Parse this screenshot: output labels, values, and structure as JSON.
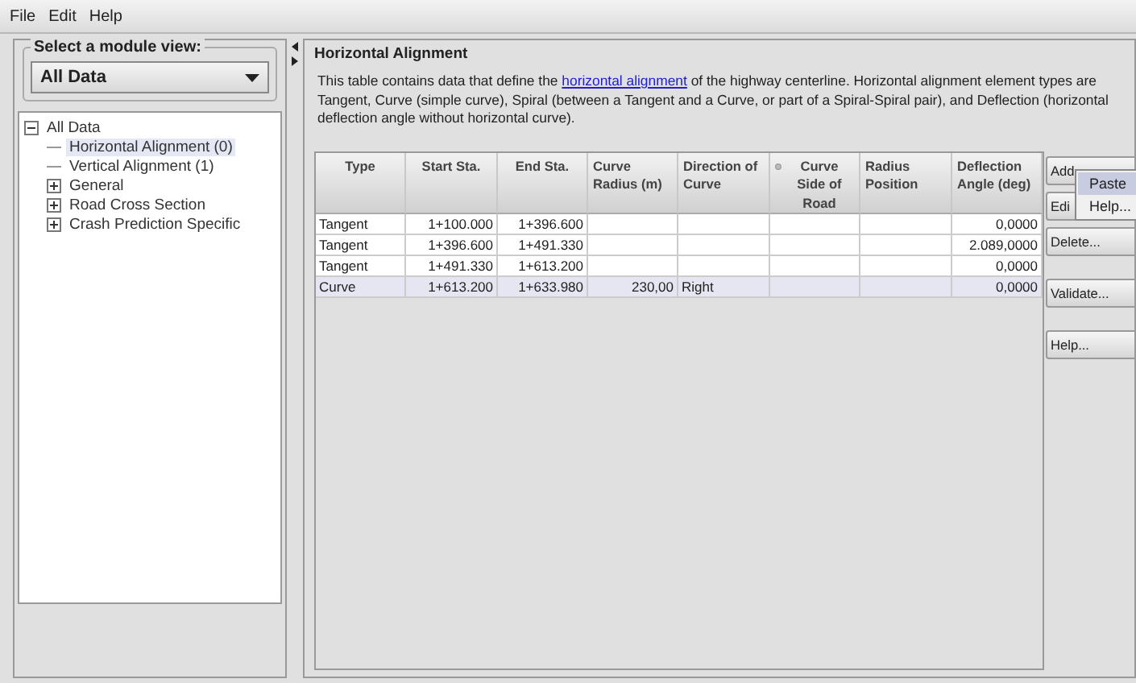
{
  "menu": [
    "File",
    "Edit",
    "Help"
  ],
  "module_view": {
    "title": "Select a module view:",
    "value": "All Data"
  },
  "tree": [
    {
      "label": "All Data",
      "expanded": true,
      "selected": false,
      "children": [
        {
          "label": "Horizontal Alignment (0)",
          "selected": true
        },
        {
          "label": "Vertical Alignment (1)",
          "selected": false
        },
        {
          "label": "General",
          "expanded": false,
          "selected": false
        },
        {
          "label": "Road Cross Section",
          "expanded": false,
          "selected": false
        },
        {
          "label": "Crash Prediction Specific",
          "expanded": false,
          "selected": false
        }
      ]
    }
  ],
  "section": {
    "title": "Horizontal Alignment",
    "description": [
      "This table contains data that define the ",
      "horizontal alignment",
      " of the highway centerline. Horizontal alignment element types are Tangent, Curve (simple curve), Spiral (between a Tangent and a Curve, or part of a Spiral-Spiral pair), and Deflection (horizontal deflection angle without horizontal curve)."
    ]
  },
  "table": {
    "columns": [
      {
        "label": "Type",
        "icon": false
      },
      {
        "label": "Start Sta.",
        "icon": false
      },
      {
        "label": "End Sta.",
        "icon": false
      },
      {
        "label": "Curve Radius (m)",
        "icon": false
      },
      {
        "label": "Direction of Curve",
        "icon": false
      },
      {
        "label": "Curve Side of Road",
        "icon": true
      },
      {
        "label": "Radius Position",
        "icon": false
      },
      {
        "label": "Deflection Angle (deg)",
        "icon": false
      }
    ],
    "rows": [
      {
        "selected": false,
        "cells": [
          "Tangent",
          "1+100.000",
          "1+396.600",
          "",
          "",
          "",
          "",
          "0,0000"
        ]
      },
      {
        "selected": false,
        "cells": [
          "Tangent",
          "1+396.600",
          "1+491.330",
          "",
          "",
          "",
          "",
          "2.089,0000"
        ]
      },
      {
        "selected": false,
        "cells": [
          "Tangent",
          "1+491.330",
          "1+613.200",
          "",
          "",
          "",
          "",
          "0,0000"
        ]
      },
      {
        "selected": true,
        "cells": [
          "Curve",
          "1+613.200",
          "1+633.980",
          "230,00",
          "Right",
          "",
          "",
          "0,0000"
        ]
      }
    ]
  },
  "button_groups": [
    [
      "Add",
      "Edi",
      "Delete..."
    ],
    [
      "Validate..."
    ],
    [
      "Help..."
    ]
  ],
  "popup_menu": [
    {
      "label": "Paste",
      "selected": true
    },
    {
      "label": "Help...",
      "selected": false
    }
  ]
}
